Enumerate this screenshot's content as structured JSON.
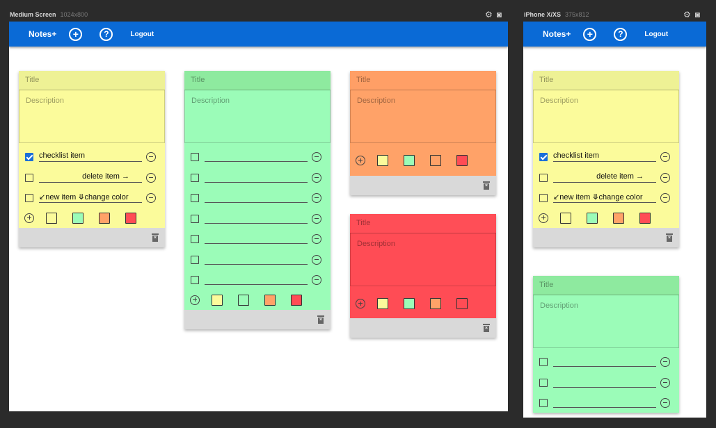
{
  "frames": [
    {
      "label": "Medium Screen",
      "size": "1024x800"
    },
    {
      "label": "iPhone X/XS",
      "size": "375x812"
    }
  ],
  "app": {
    "brand": "Notes+",
    "add_glyph": "+",
    "help_glyph": "?",
    "logout": "Logout"
  },
  "note": {
    "title_placeholder": "Title",
    "description_placeholder": "Description"
  },
  "checklist": {
    "item1": "checklist item",
    "item2": "delete item →",
    "item3": "↙new item ⤋change color"
  },
  "colors": {
    "yellow": "#fbfb9b",
    "green": "#9bfcb8",
    "orange": "#ffa268",
    "red": "#ff4c55",
    "appbar": "#0a6ad6"
  },
  "icons": [
    "settings-icon",
    "camera-icon",
    "add-icon",
    "help-icon",
    "checkbox-icon",
    "remove-circle-icon",
    "add-circle-icon",
    "trash-icon"
  ]
}
